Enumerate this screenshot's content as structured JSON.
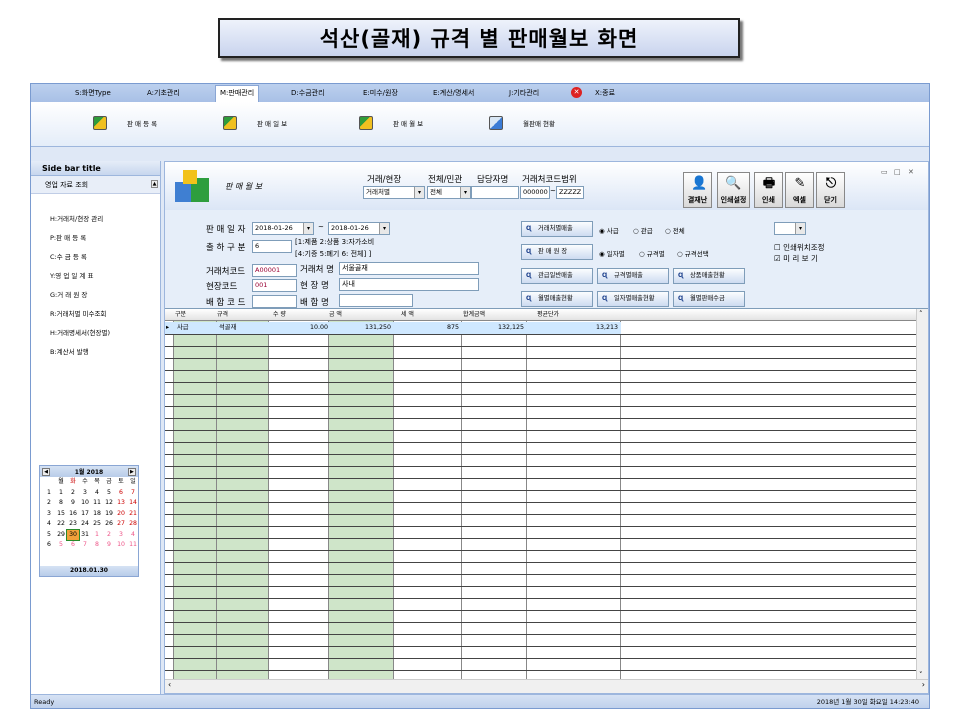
{
  "title": "석산(골재) 규격 별 판매월보  화면",
  "menu": [
    {
      "label": "S:화면Type"
    },
    {
      "label": "A:기초관리"
    },
    {
      "label": "M:판매관리"
    },
    {
      "label": "D:수금관리"
    },
    {
      "label": "E:미수/원장"
    },
    {
      "label": "E:계산/명세서"
    },
    {
      "label": "J:기타관리"
    },
    {
      "label": "X:종료"
    }
  ],
  "ribbon": [
    {
      "label": "판 매 등 록"
    },
    {
      "label": "판 매 일 보"
    },
    {
      "label": "판 매 월 보"
    },
    {
      "label": "월판매 현황"
    }
  ],
  "sidebar": {
    "title": "Side bar title",
    "section": "영업 자료 조회",
    "items": [
      "H:거래처/현장 관리",
      "P:판 매 등 록",
      "C:수 금 등 록",
      "Y:영 업 일 계 표",
      "G:거 래 원 장",
      "R:거래처별 미수조회",
      "H:거래명세서(현장별)",
      "B:계산서 발행"
    ]
  },
  "calendar": {
    "month": "1월 2018",
    "weekdays": [
      "월",
      "화",
      "수",
      "목",
      "금",
      "토",
      "일"
    ],
    "weeks": [
      [
        "1",
        "1",
        "2",
        "3",
        "4",
        "5",
        "6",
        "7"
      ],
      [
        "2",
        "8",
        "9",
        "10",
        "11",
        "12",
        "13",
        "14"
      ],
      [
        "3",
        "15",
        "16",
        "17",
        "18",
        "19",
        "20",
        "21"
      ],
      [
        "4",
        "22",
        "23",
        "24",
        "25",
        "26",
        "27",
        "28"
      ],
      [
        "5",
        "29",
        "30",
        "31",
        "1",
        "2",
        "3",
        "4"
      ],
      [
        "6",
        "5",
        "6",
        "7",
        "8",
        "9",
        "10",
        "11"
      ]
    ],
    "footer": "2018.01.30"
  },
  "panel": {
    "title": "판 매 월 보"
  },
  "filters": {
    "group_label": "거래/현장",
    "group_value": "거래처별",
    "scope_label": "전체/민관",
    "scope_value": "전체",
    "manager_label": "담당자명",
    "manager_value": "",
    "range_label": "거래처코드범위",
    "range_from": "000000",
    "range_sep": "~",
    "range_to": "ZZZZZ"
  },
  "toolbar": {
    "approve": "결재난",
    "print_setup": "인쇄설정",
    "print": "인쇄",
    "excel": "엑셀",
    "close": "닫기"
  },
  "form": {
    "date_label": "판 매 일 자",
    "date_from": "2018-01-26",
    "date_sep": "~",
    "date_to": "2018-01-26",
    "ship_label": "출 하 구 분",
    "ship_value": "6",
    "ship_hint1": "[1:제품 2:상품 3:자가소비",
    "ship_hint2": "[4:기증 5:폐기 6: 전체] ]",
    "cust_code_label": "거래처코드",
    "cust_code": "A00001",
    "cust_name_label": "거래처 명",
    "cust_name": "서울골재",
    "site_code_label": "현장코드",
    "site_code": "001",
    "site_name_label": "현 장 명",
    "site_name": "사내",
    "mix_code_label": "배 합 코 드",
    "mix_code": "",
    "mix_name_label": "배 합 명",
    "mix_name": ""
  },
  "actions": {
    "b1": "거래처별매출",
    "b2": "판 매 원 장",
    "b3": "관급일반매출",
    "b4": "규격별매출",
    "b5": "상품매출현황",
    "b6": "월별매출현황",
    "b7": "일자별매출현황",
    "b8": "월별판매수금"
  },
  "radios": {
    "r1": [
      "사급",
      "관급",
      "전체"
    ],
    "r2": [
      "일자별",
      "규격별",
      "규격선택"
    ]
  },
  "print_opts": {
    "opt1": "인쇄위치조정",
    "opt2": "미 리 보 기"
  },
  "grid": {
    "headers": [
      "구분",
      "규격",
      "수 량",
      "금 액",
      "세 액",
      "합계금액",
      "평균단가"
    ],
    "rows": [
      [
        "사급",
        "석골재",
        "10.00",
        "131,250",
        "875",
        "132,125",
        "13,213"
      ]
    ]
  },
  "status": {
    "left": "Ready",
    "right": "2018년 1월 30일 화요일 14:23:40"
  }
}
